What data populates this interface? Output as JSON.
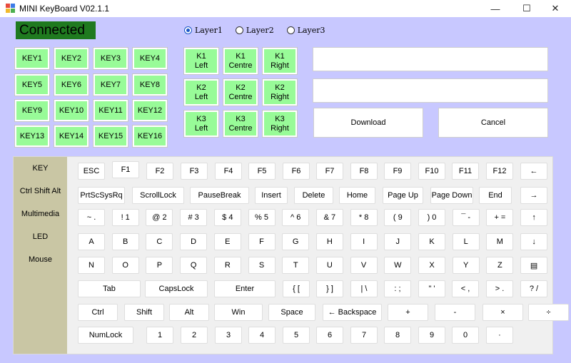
{
  "window": {
    "title": "MINI KeyBoard V02.1.1",
    "minimize": "—",
    "maximize": "☐",
    "close": "✕"
  },
  "status": {
    "connected": "Connected"
  },
  "layers": [
    "Layer1",
    "Layer2",
    "Layer3"
  ],
  "layer_selected": "Layer1",
  "key_grid": [
    "KEY1",
    "KEY2",
    "KEY3",
    "KEY4",
    "KEY5",
    "KEY6",
    "KEY7",
    "KEY8",
    "KEY9",
    "KEY10",
    "KEY11",
    "KEY12",
    "KEY13",
    "KEY14",
    "KEY15",
    "KEY16"
  ],
  "knobs": [
    [
      "K1",
      "Left"
    ],
    [
      "K1",
      "Centre"
    ],
    [
      "K1",
      "Right"
    ],
    [
      "K2",
      "Left"
    ],
    [
      "K2",
      "Centre"
    ],
    [
      "K2",
      "Right"
    ],
    [
      "K3",
      "Left"
    ],
    [
      "K3",
      "Centre"
    ],
    [
      "K3",
      "Right"
    ]
  ],
  "actions": {
    "download": "Download",
    "cancel": "Cancel"
  },
  "categories": [
    "KEY",
    "Ctrl Shift Alt",
    "Multimedia",
    "LED",
    "Mouse"
  ],
  "keyboard_rows": [
    [
      "ESC",
      "F1",
      "F2",
      "F3",
      "F4",
      "F5",
      "F6",
      "F7",
      "F8",
      "F9",
      "F10",
      "F11",
      "F12",
      "←"
    ],
    [
      "PrtScSysRq",
      "ScrollLock",
      "PauseBreak",
      "Insert",
      "Delete",
      "Home",
      "Page Up",
      "Page Down",
      "End",
      "→"
    ],
    [
      "~ .",
      "! 1",
      "@ 2",
      "# 3",
      "$ 4",
      "% 5",
      "^ 6",
      "& 7",
      "* 8",
      "( 9",
      ") 0",
      "¯ -",
      "+ =",
      "↑"
    ],
    [
      "A",
      "B",
      "C",
      "D",
      "E",
      "F",
      "G",
      "H",
      "I",
      "J",
      "K",
      "L",
      "M",
      "↓"
    ],
    [
      "N",
      "O",
      "P",
      "Q",
      "R",
      "S",
      "T",
      "U",
      "V",
      "W",
      "X",
      "Y",
      "Z",
      "▤"
    ],
    [
      "Tab",
      "CapsLock",
      "Enter",
      "{ [",
      "} ]",
      "| \\",
      ": ;",
      "\" '",
      "< ,",
      "> .",
      "? /"
    ],
    [
      "Ctrl",
      "Shift",
      "Alt",
      "Win",
      "Space",
      "← Backspace",
      "+",
      "-",
      "×",
      "÷"
    ],
    [
      "NumLock",
      "1",
      "2",
      "3",
      "4",
      "5",
      "6",
      "7",
      "8",
      "9",
      "0",
      "·"
    ]
  ]
}
